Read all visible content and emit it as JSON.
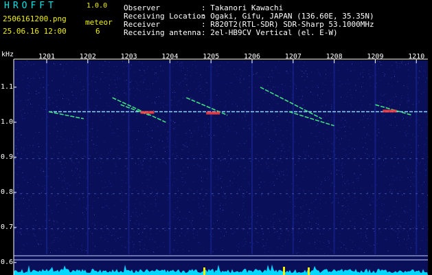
{
  "header": {
    "app_title": "HROFFT",
    "version": "1.0.0",
    "filename": "2506161200.png",
    "datetime": "25.06.16 12:00",
    "meteor_label": "meteor",
    "meteor_count": "6"
  },
  "station_info": [
    {
      "label": "Observer",
      "value": ": Takanori Kawachi"
    },
    {
      "label": "Receiving Location",
      "value": ": Ogaki, Gifu, JAPAN (136.60E, 35.35N)"
    },
    {
      "label": "Receiver",
      "value": ": R820T2(RTL-SDR) SDR-Sharp 53.1000MHz"
    },
    {
      "label": "Receiving antenna",
      "value": ": 2el-HB9CV Vertical (el. E-W)"
    }
  ],
  "spectrogram": {
    "y_unit_label": "kHz",
    "x_tick_labels": [
      "1201",
      "1202",
      "1203",
      "1204",
      "1205",
      "1206",
      "1207",
      "1208",
      "1209",
      "1210"
    ],
    "x_ticks_minutes": [
      1,
      2,
      3,
      4,
      5,
      6,
      7,
      8,
      9,
      10
    ],
    "y_tick_labels": [
      "1.1",
      "1.0",
      "0.9",
      "0.8",
      "0.7",
      "0.6"
    ],
    "y_ticks_khz": [
      1.1,
      1.0,
      0.9,
      0.8,
      0.7,
      0.6
    ],
    "y_range_khz": [
      0.58,
      1.18
    ],
    "x_range_minutes": [
      0,
      10
    ],
    "carrier_khz": 1.03,
    "meteor_tracks": [
      {
        "start_min": 1.05,
        "end_min": 1.9,
        "start_khz": 1.03,
        "end_khz": 1.01
      },
      {
        "start_min": 2.6,
        "end_min": 3.9,
        "start_khz": 1.07,
        "end_khz": 1.0
      },
      {
        "start_min": 2.8,
        "end_min": 3.5,
        "start_khz": 1.05,
        "end_khz": 1.02
      },
      {
        "start_min": 4.4,
        "end_min": 5.4,
        "start_khz": 1.07,
        "end_khz": 1.02
      },
      {
        "start_min": 6.2,
        "end_min": 7.7,
        "start_khz": 1.1,
        "end_khz": 1.01
      },
      {
        "start_min": 6.9,
        "end_min": 8.0,
        "start_khz": 1.03,
        "end_khz": 0.99
      },
      {
        "start_min": 9.0,
        "end_min": 9.9,
        "start_khz": 1.05,
        "end_khz": 1.02
      }
    ],
    "colors": {
      "background": "#0a0f5a",
      "label_cyan": "#00e6e6",
      "label_yellow": "#f2f200",
      "carrier": "#8fd8ff",
      "track_green": "#40e080",
      "track_red": "#ff4040",
      "noise_cyan": "#00d8ff"
    }
  }
}
